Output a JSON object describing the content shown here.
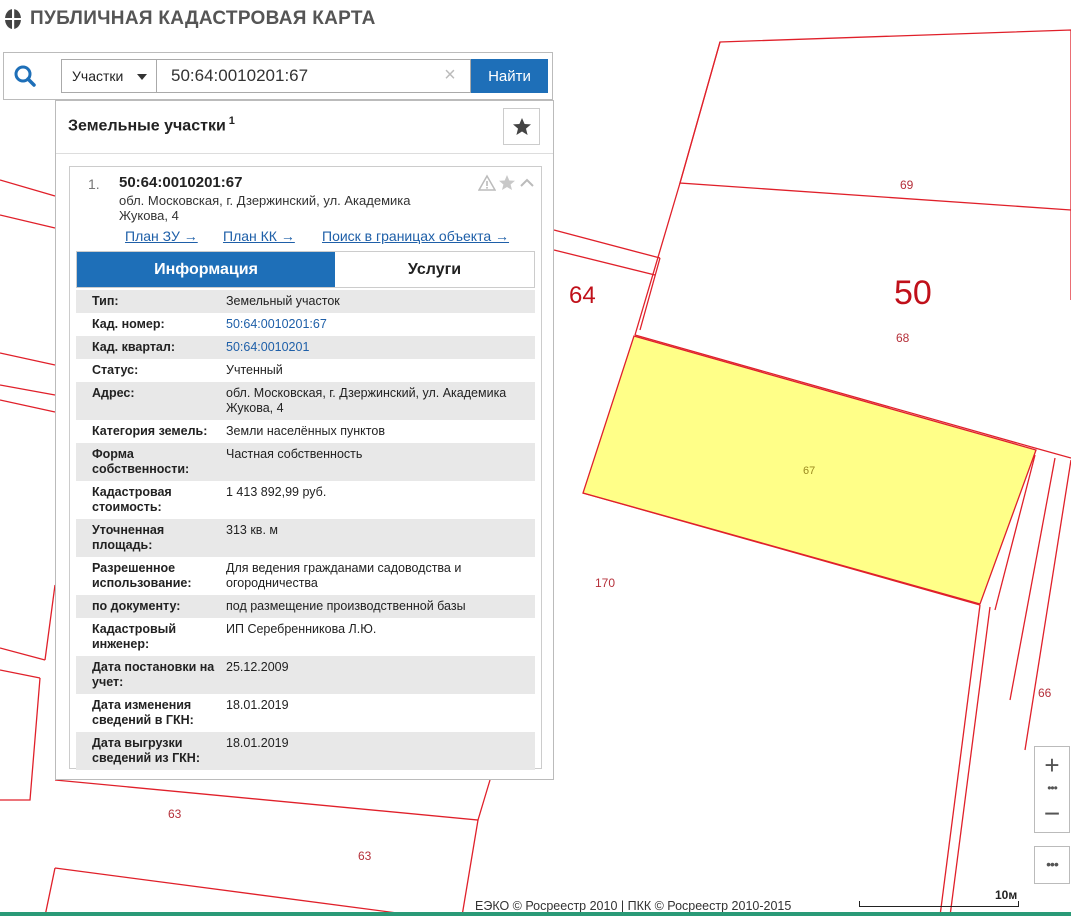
{
  "app": {
    "title": "ПУБЛИЧНАЯ КАДАСТРОВАЯ КАРТА"
  },
  "search": {
    "type_label": "Участки",
    "value": "50:64:0010201:67",
    "clear_glyph": "×",
    "find_label": "Найти"
  },
  "panel": {
    "title": "Земельные участки",
    "count": "1"
  },
  "result": {
    "number": "1.",
    "cad_number": "50:64:0010201:67",
    "address": "обл. Московская, г. Дзержинский, ул. Академика Жукова, 4",
    "links": {
      "plan_zu": "План ЗУ →",
      "plan_kk": "План КК →",
      "search_bounds": "Поиск в границах объекта →"
    },
    "tabs": {
      "info": "Информация",
      "services": "Услуги"
    },
    "properties": [
      {
        "label": "Тип:",
        "value": "Земельный участок"
      },
      {
        "label": "Кад. номер:",
        "value": "50:64:0010201:67"
      },
      {
        "label": "Кад. квартал:",
        "value": "50:64:0010201"
      },
      {
        "label": "Статус:",
        "value": "Учтенный"
      },
      {
        "label": "Адрес:",
        "value": "обл. Московская, г. Дзержинский, ул. Академика Жукова, 4"
      },
      {
        "label": "Категория земель:",
        "value": "Земли населённых пунктов"
      },
      {
        "label": "Форма собственности:",
        "value": "Частная собственность"
      },
      {
        "label": "Кадастровая стоимость:",
        "value": "1 413 892,99 руб."
      },
      {
        "label": "Уточненная площадь:",
        "value": "313 кв. м"
      },
      {
        "label": "Разрешенное использование:",
        "value": "Для ведения гражданами садоводства и огородничества"
      },
      {
        "label": "по документу:",
        "value": "под размещение производственной базы"
      },
      {
        "label": "Кадастровый инженер:",
        "value": "ИП Серебренникова Л.Ю."
      },
      {
        "label": "Дата постановки на учет:",
        "value": "25.12.2009"
      },
      {
        "label": "Дата изменения сведений в ГКН:",
        "value": "18.01.2019"
      },
      {
        "label": "Дата выгрузки сведений из ГКН:",
        "value": "18.01.2019"
      }
    ]
  },
  "map": {
    "labels": {
      "l69": "69",
      "l64": "64",
      "l50": "50",
      "l68": "68",
      "l67": "67",
      "l170": "170",
      "l66": "66",
      "l63a": "63",
      "l63b": "63"
    },
    "selected_fill": "#ffff88",
    "boundary_color": "#e0202a"
  },
  "controls": {
    "zoom_in": "+",
    "zoom_levels": "•••",
    "zoom_out": "−",
    "more": "•••"
  },
  "footer": {
    "attribution": "ЕЭКО © Росреестр 2010 | ПКК © Росреестр 2010-2015",
    "scale_label": "10м"
  }
}
